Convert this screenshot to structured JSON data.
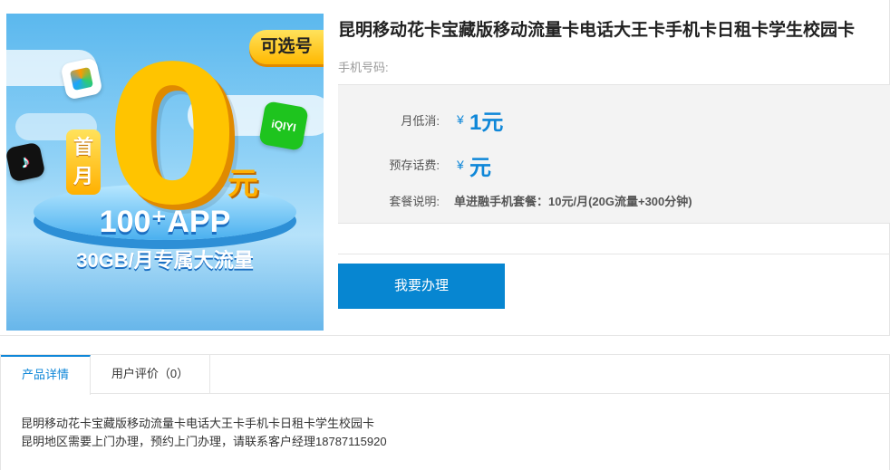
{
  "banner": {
    "tag": "可选号",
    "first_month": "首月",
    "zero": "0",
    "yuan": "元",
    "app_count": "100⁺APP",
    "traffic": "30GB/月专属大流量",
    "icons": [
      "tencent-video-icon",
      "iqiyi-icon",
      "tiktok-icon"
    ],
    "iqiyi_text": "iQIYI"
  },
  "product": {
    "title": "昆明移动花卡宝藏版移动流量卡电话大王卡手机卡日租卡学生校园卡",
    "phone_label": "手机号码:",
    "monthly_min_label": "月低消:",
    "currency": "¥",
    "monthly_min_value": "1元",
    "prepaid_label": "预存话费:",
    "prepaid_value": "元",
    "plan_label": "套餐说明:",
    "plan_value": "单进融手机套餐：10元/月(20G流量+300分钟)",
    "apply_button": "我要办理"
  },
  "tabs": [
    {
      "label": "产品详情",
      "active": true
    },
    {
      "label": "用户评价（0）",
      "active": false
    }
  ],
  "detail": {
    "line1": "昆明移动花卡宝藏版移动流量卡电话大王卡手机卡日租卡学生校园卡",
    "line2": "昆明地区需要上门办理，预约上门办理，请联系客户经理18787115920"
  },
  "colors": {
    "accent": "#0f87d8",
    "button": "#0786d1",
    "panel_bg": "#f3f3f3"
  }
}
